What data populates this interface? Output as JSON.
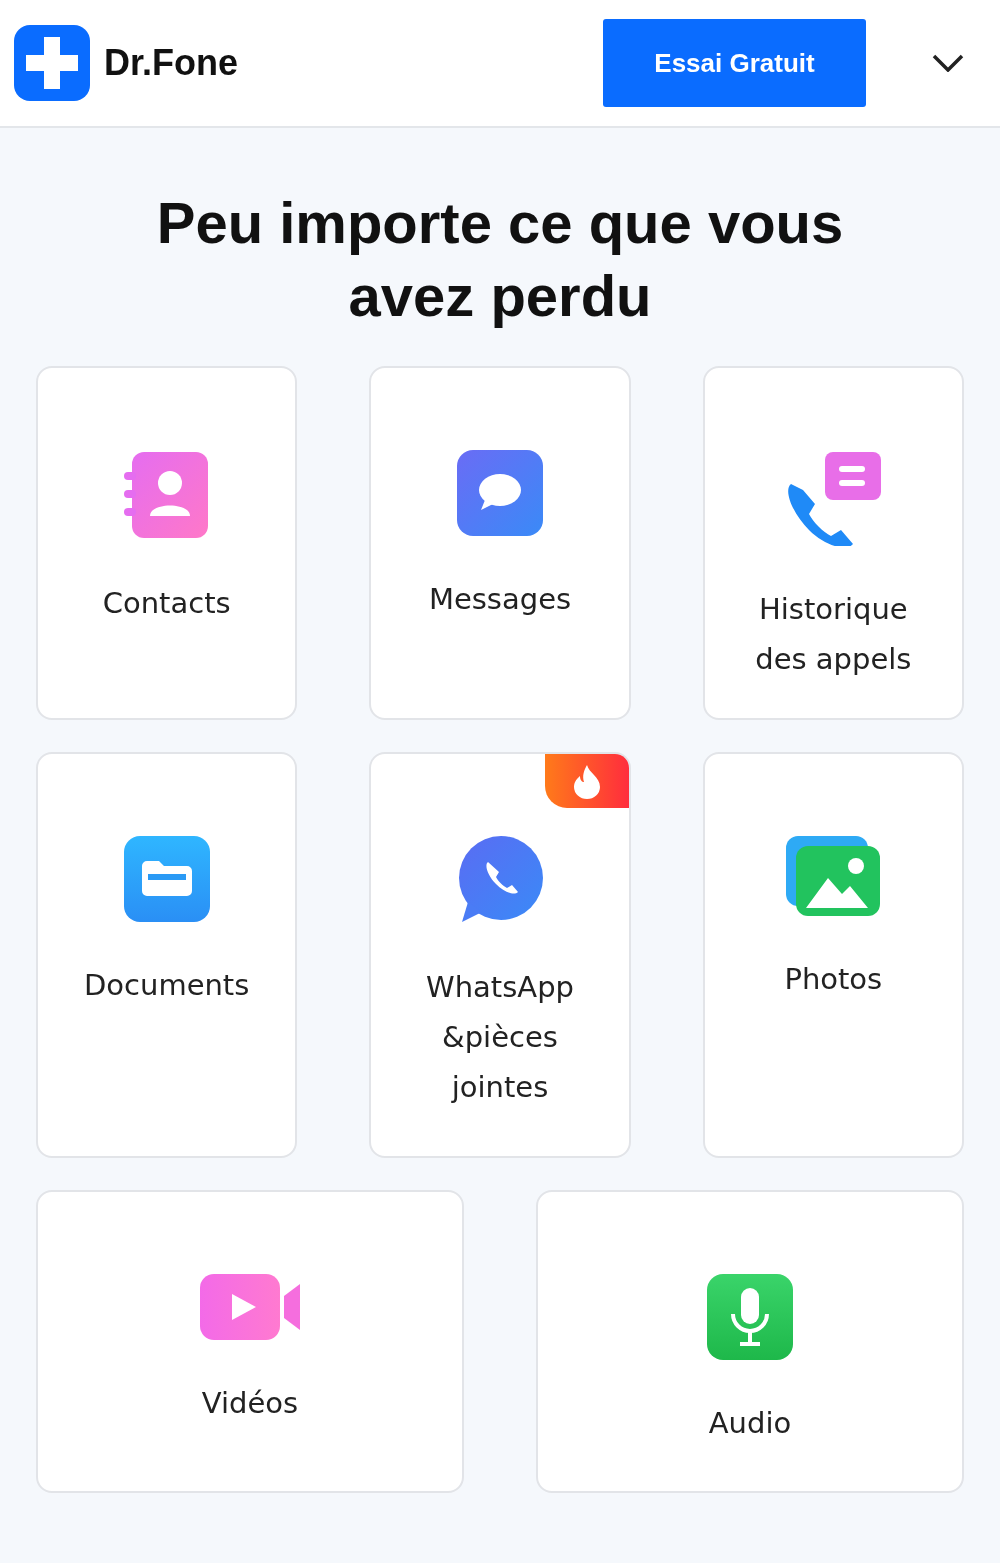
{
  "header": {
    "logo_text": "Dr.Fone",
    "button": "Essai Gratuit"
  },
  "title": "Peu importe ce que vous avez perdu",
  "categories": [
    {
      "kind": "contacts",
      "label": "Contacts",
      "hot": false
    },
    {
      "kind": "messages",
      "label": "Messages",
      "hot": false
    },
    {
      "kind": "calls",
      "label": "Historique\ndes appels",
      "hot": false
    },
    {
      "kind": "documents",
      "label": "Documents",
      "hot": false
    },
    {
      "kind": "whatsapp",
      "label": "WhatsApp\n&pièces\njointes",
      "hot": true
    },
    {
      "kind": "photos",
      "label": "Photos",
      "hot": false
    },
    {
      "kind": "videos",
      "label": "Vidéos",
      "hot": false
    },
    {
      "kind": "audio",
      "label": "Audio",
      "hot": false
    }
  ]
}
